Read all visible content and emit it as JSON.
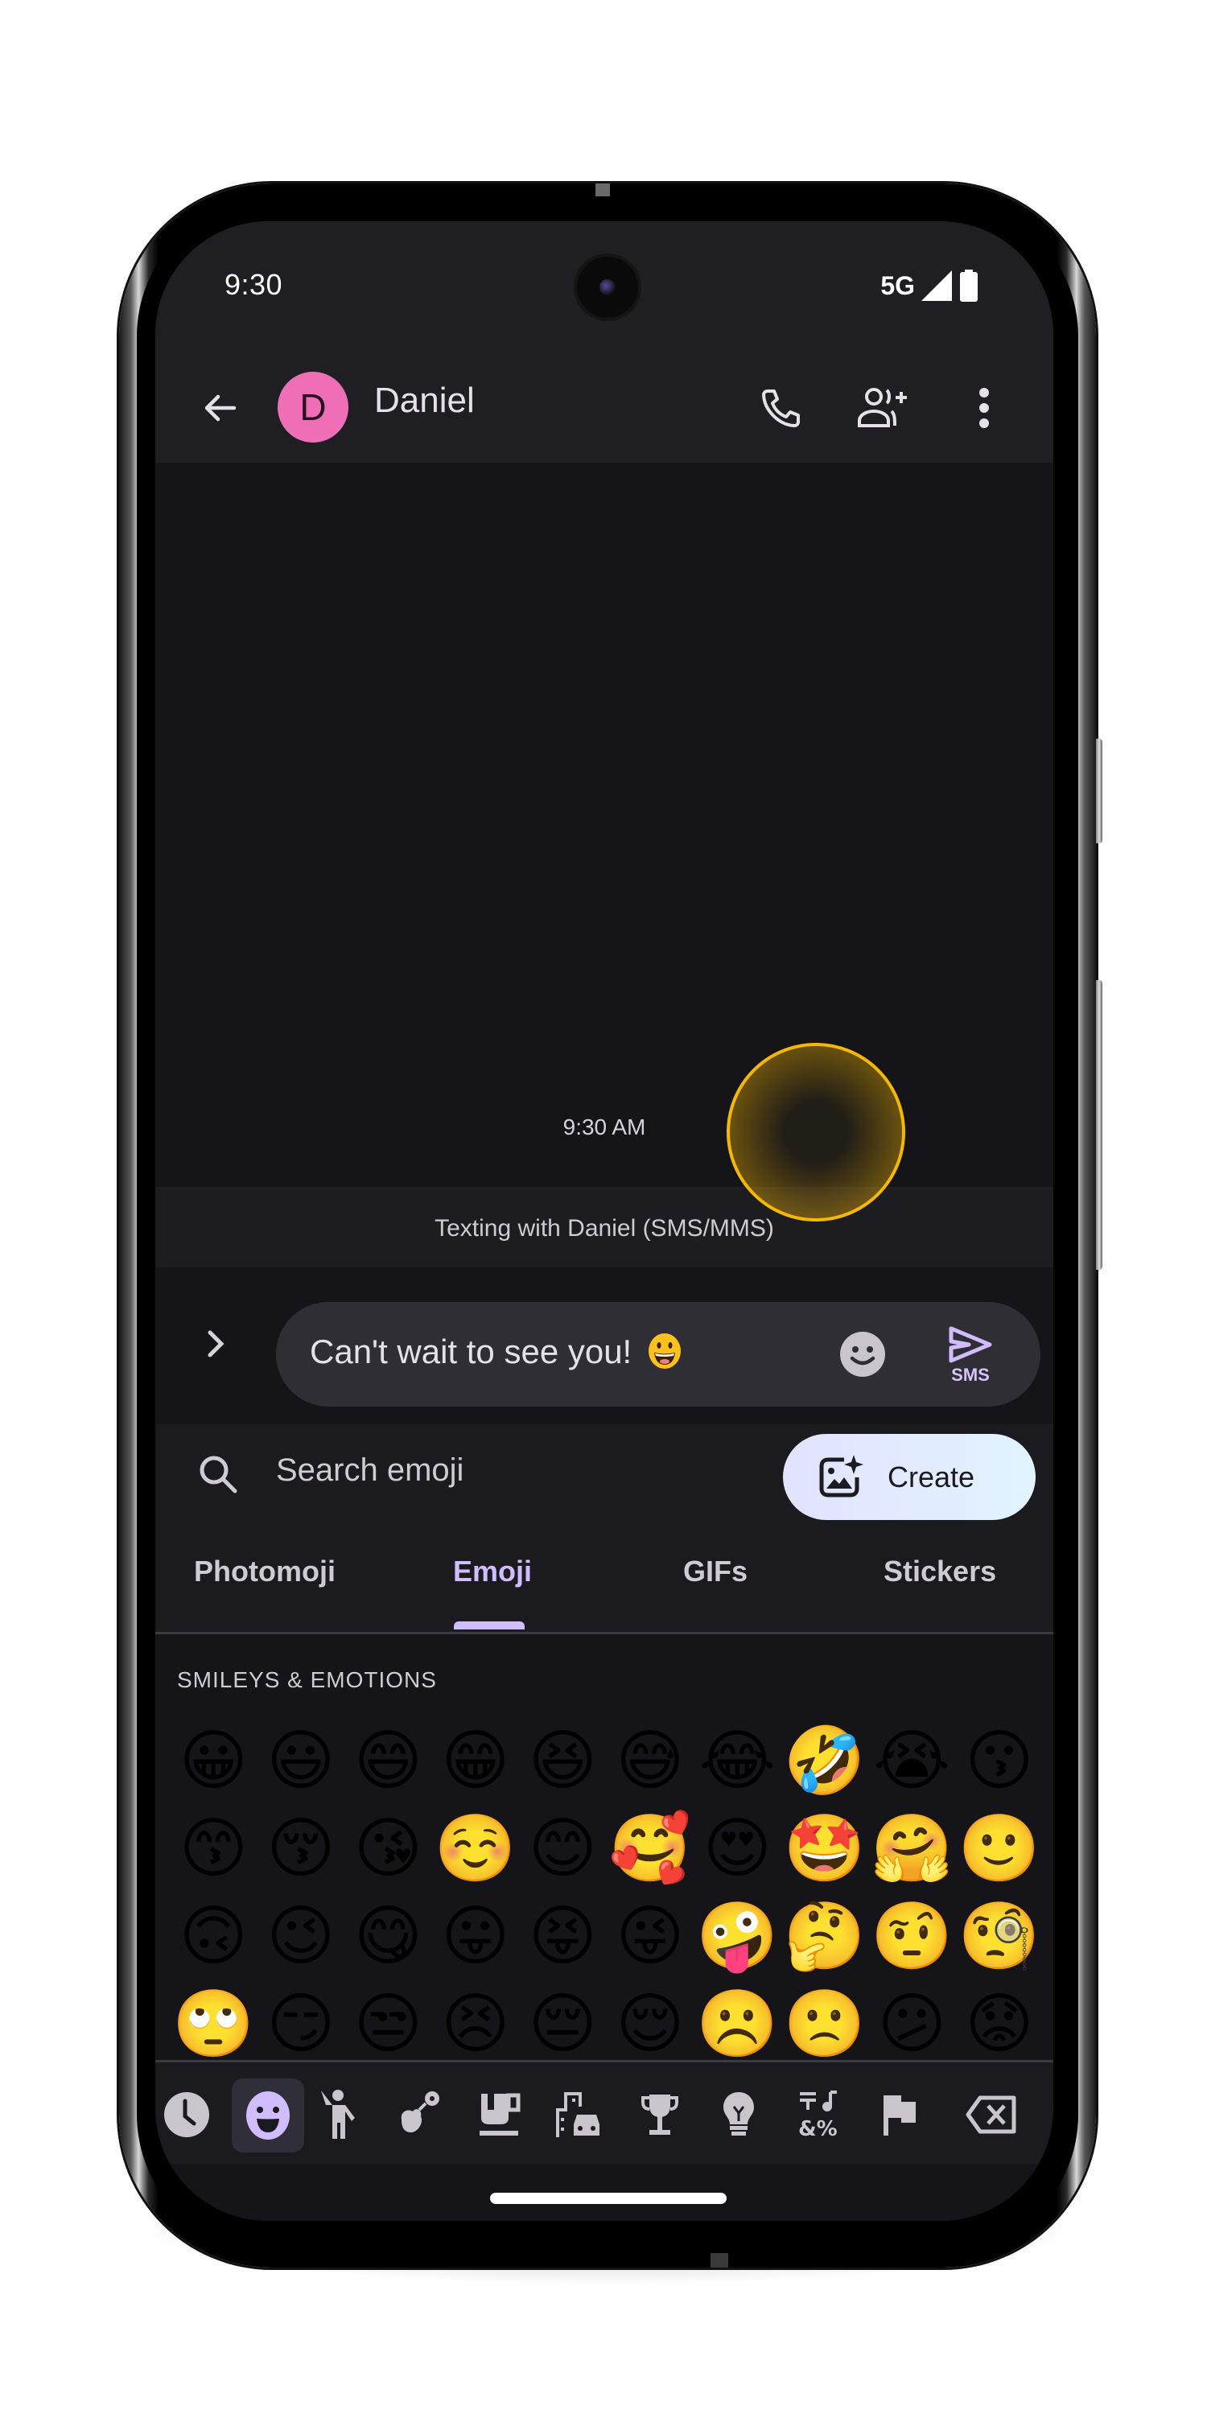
{
  "status_bar": {
    "time": "9:30",
    "network": "5G",
    "icons": [
      "signal-icon",
      "battery-icon"
    ]
  },
  "header": {
    "back_icon": "arrow-back-icon",
    "avatar_letter": "D",
    "contact_name": "Daniel",
    "actions": [
      "phone-icon",
      "add-person-icon",
      "more-vert-icon"
    ],
    "avatar_color": "#ee6fb6"
  },
  "conversation": {
    "timestamp": "9:30 AM",
    "texting_info": "Texting with Daniel (SMS/MMS)"
  },
  "compose": {
    "expand_icon": "chevron-right-icon",
    "message_text": "Can't wait to see you!",
    "message_emoji": "😀",
    "emoji_button_icon": "smiley-icon",
    "send_label": "SMS",
    "send_icon": "send-icon",
    "accent_color": "#d0bcff",
    "highlight_color": "#f5b800"
  },
  "emoji_panel": {
    "search_placeholder": "Search emoji",
    "create_label": "Create",
    "tabs": [
      {
        "label": "Photomoji",
        "active": false
      },
      {
        "label": "Emoji",
        "active": true
      },
      {
        "label": "GIFs",
        "active": false
      },
      {
        "label": "Stickers",
        "active": false
      }
    ],
    "section_label": "SMILEYS & EMOTIONS",
    "emojis": [
      "😀",
      "😃",
      "😄",
      "😁",
      "😆",
      "😅",
      "😂",
      "🤣",
      "😭",
      "😗",
      "😙",
      "😚",
      "😘",
      "☺️",
      "😊",
      "🥰",
      "😍",
      "🤩",
      "🤗",
      "🙂",
      "🙃",
      "😉",
      "😋",
      "😛",
      "😝",
      "😜",
      "🤪",
      "🤔",
      "🤨",
      "🧐",
      "🙄",
      "😏",
      "😒",
      "😣",
      "😔",
      "😌",
      "☹️",
      "🙁",
      "😕",
      "😟"
    ],
    "categories": [
      {
        "name": "recent-icon",
        "active": false
      },
      {
        "name": "smileys-icon",
        "active": true
      },
      {
        "name": "people-icon",
        "active": false
      },
      {
        "name": "animals-nature-icon",
        "active": false
      },
      {
        "name": "food-drink-icon",
        "active": false
      },
      {
        "name": "travel-places-icon",
        "active": false
      },
      {
        "name": "activities-icon",
        "active": false
      },
      {
        "name": "objects-icon",
        "active": false
      },
      {
        "name": "symbols-icon",
        "active": false
      },
      {
        "name": "flags-icon",
        "active": false
      },
      {
        "name": "backspace-icon",
        "active": false
      }
    ]
  }
}
